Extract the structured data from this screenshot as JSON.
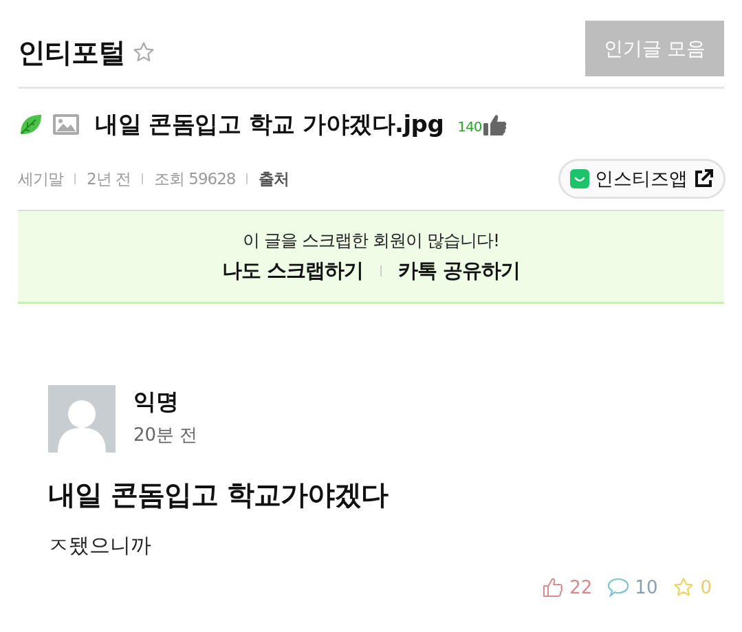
{
  "board": {
    "title": "인티포털",
    "favorited": false
  },
  "popular_button": "인기글 모음",
  "post": {
    "title": "내일 콘돔입고 학교 가야겠다.jpg",
    "likes": "140"
  },
  "meta": {
    "author": "세기말",
    "time": "2년 전",
    "views": "조회 59628",
    "source": "출처"
  },
  "app_link": "인스티즈앱",
  "scrap_banner": {
    "message": "이 글을 스크랩한 회원이 많습니다!",
    "actions": [
      "나도 스크랩하기",
      "카톡 공유하기"
    ]
  },
  "embedded_post": {
    "author": "익명",
    "time": "20분 전",
    "title": "내일 콘돔입고 학교가야겠다",
    "body": "ㅈ됐으니까",
    "stats": [
      {
        "kind": "like",
        "count": "22"
      },
      {
        "kind": "comment",
        "count": "10"
      },
      {
        "kind": "star",
        "count": "0"
      }
    ]
  }
}
